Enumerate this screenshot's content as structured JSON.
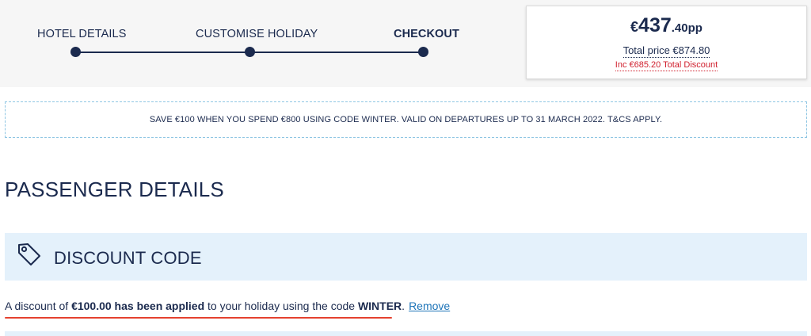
{
  "stepper": {
    "steps": [
      {
        "label": "HOTEL DETAILS",
        "active": false
      },
      {
        "label": "CUSTOMISE HOLIDAY",
        "active": false
      },
      {
        "label": "CHECKOUT",
        "active": true
      }
    ]
  },
  "price": {
    "currency": "€",
    "whole": "437",
    "fraction": ".40pp",
    "total": "Total price €874.80",
    "discount": "Inc €685.20 Total Discount"
  },
  "promo": {
    "text": "SAVE €100 WHEN YOU SPEND €800 USING CODE WINTER. VALID ON DEPARTURES UP TO 31 MARCH 2022. T&CS APPLY."
  },
  "page": {
    "title": "PASSENGER DETAILS"
  },
  "discount_code": {
    "icon": "tag-icon",
    "title": "DISCOUNT CODE",
    "message": {
      "pre": "A discount of ",
      "amount_bold": "€100.00 has been applied",
      "mid": " to your holiday using the code ",
      "code_bold": "WINTER",
      "post": ".",
      "remove_label": "Remove"
    }
  },
  "colors": {
    "navy": "#1b2a4e",
    "discount_red": "#d0202e",
    "panel_blue": "#e4f1fb",
    "link_blue": "#1d74b8",
    "underline_red": "#e5412f"
  }
}
